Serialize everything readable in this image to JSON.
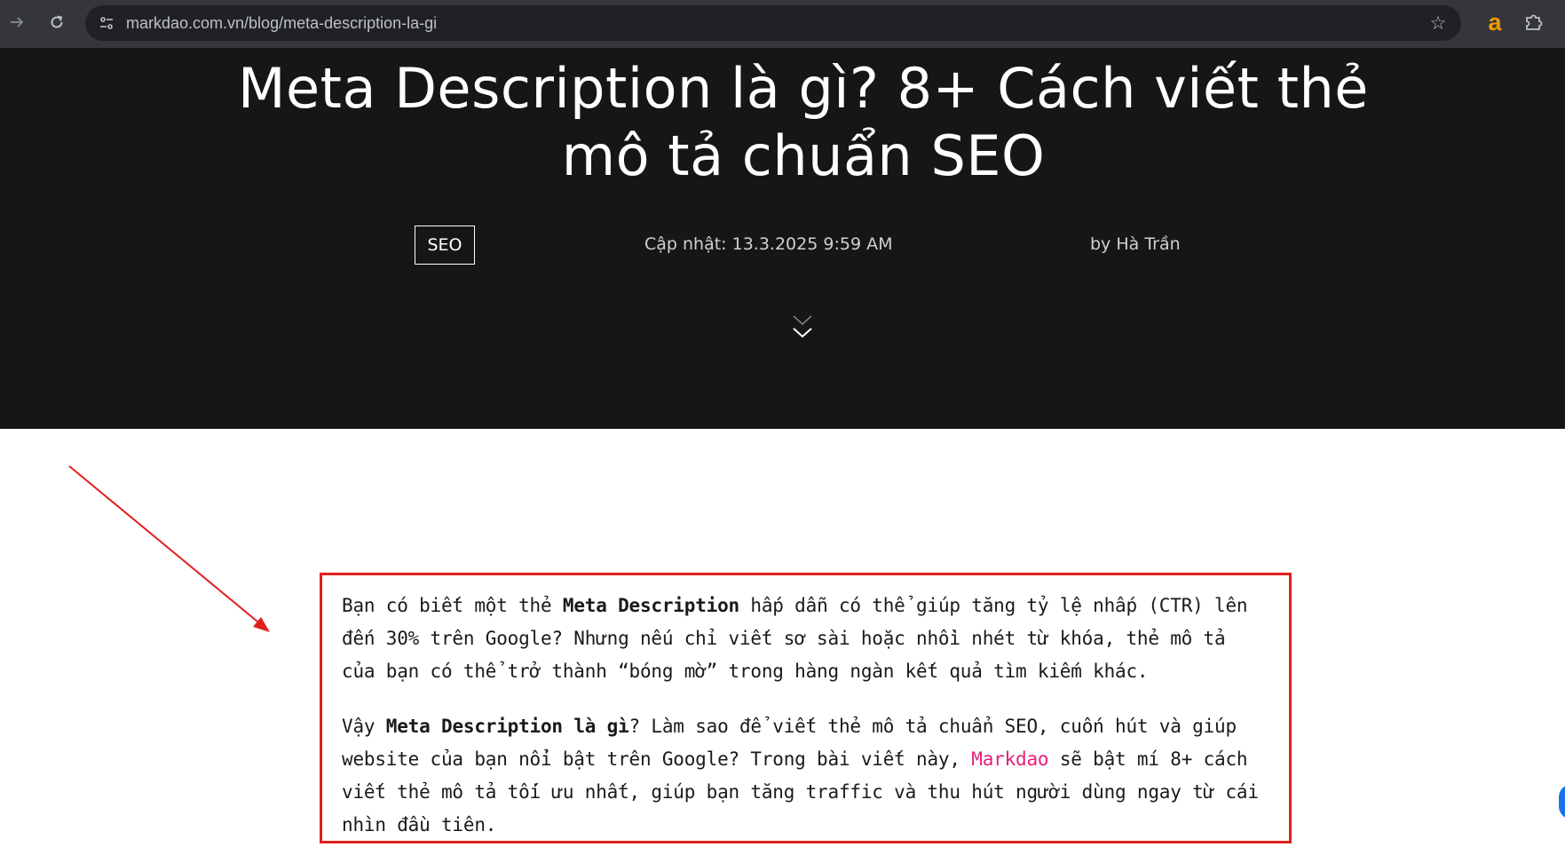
{
  "browser": {
    "url": "markdao.com.vn/blog/meta-description-la-gi",
    "extension_letter": "a",
    "icons": [
      "forward-icon",
      "reload-icon",
      "site-info-icon",
      "bookmark-star-icon",
      "puzzle-icon"
    ]
  },
  "hero": {
    "title": "Meta Description là gì? 8+ Cách viết thẻ mô tả chuẩn SEO",
    "category": "SEO",
    "updated": "Cập nhật: 13.3.2025 9:59 AM",
    "author": "by Hà Trần",
    "background_color": "#161616"
  },
  "intro": {
    "p1_before": "Bạn có biết một thẻ ",
    "p1_bold": "Meta Description",
    "p1_after": " hấp dẫn có thể giúp tăng tỷ lệ nhấp (CTR) lên đến 30% trên Google? Nhưng nếu chỉ viết sơ sài hoặc nhồi nhét từ khóa, thẻ mô tả của bạn có thể trở thành “bóng mờ” trong hàng ngàn kết quả tìm kiếm khác.",
    "p2_before": "Vậy ",
    "p2_bold": "Meta Description là gì",
    "p2_mid": "? Làm sao để viết thẻ mô tả chuẩn SEO, cuốn hút và giúp website của bạn nổi bật trên Google? Trong bài viết này, ",
    "p2_link": "Markdao",
    "p2_after": " sẽ bật mí 8+ cách viết thẻ mô tả tối ưu nhất, giúp bạn tăng traffic và thu hút người dùng ngay từ cái nhìn đầu tiên."
  },
  "colors": {
    "annotation_red": "#e0201c",
    "link_pink": "#e6207a",
    "chrome_bg": "#35363a"
  }
}
